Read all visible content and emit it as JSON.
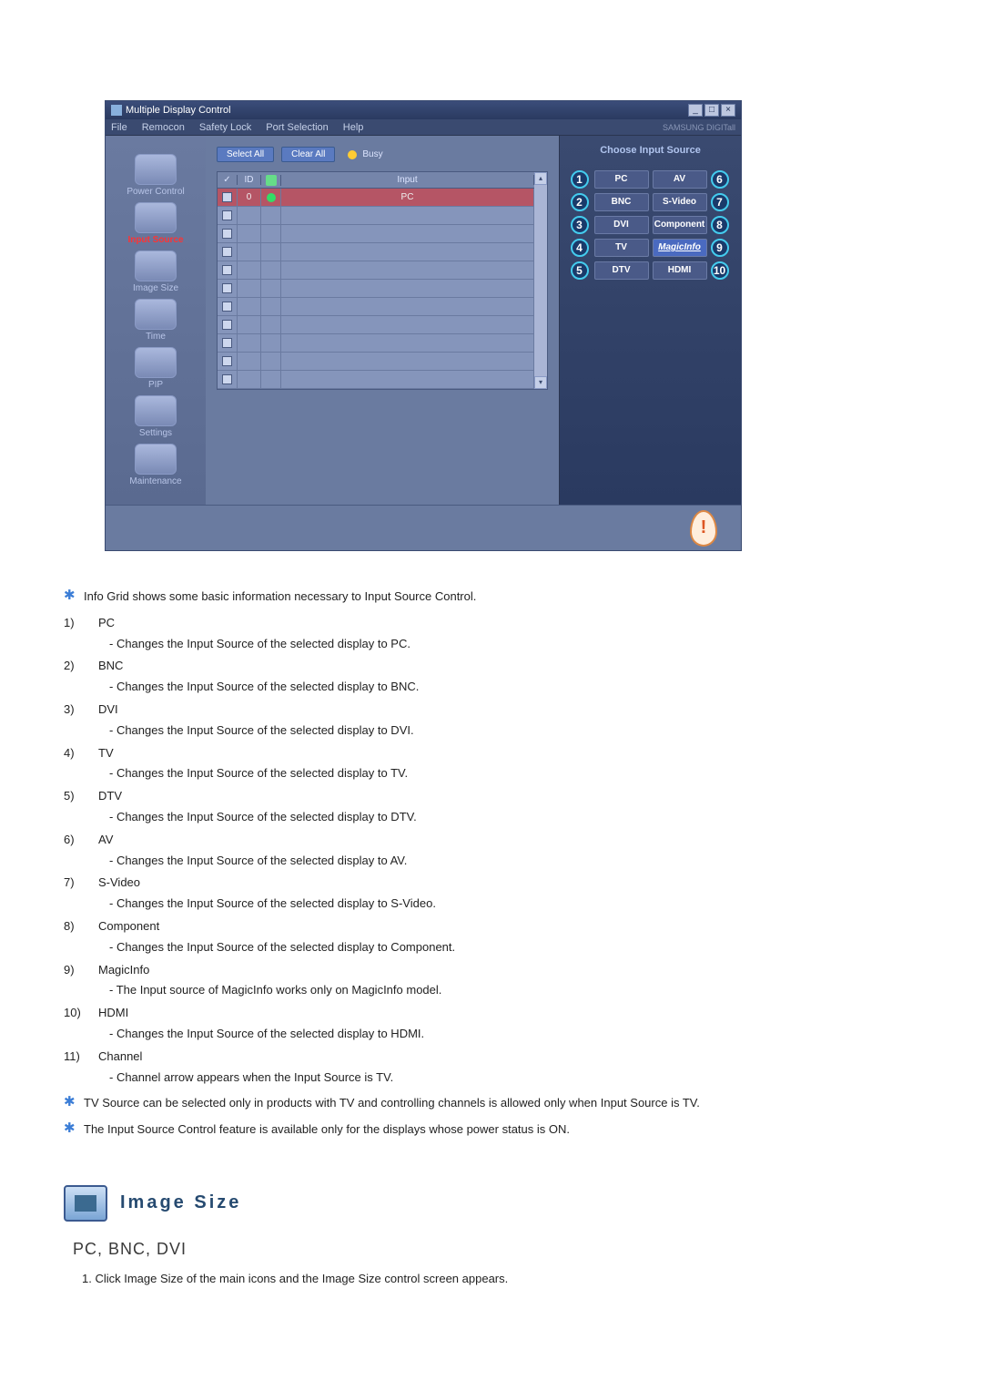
{
  "window": {
    "title": "Multiple Display Control",
    "menubar": [
      "File",
      "Remocon",
      "Safety Lock",
      "Port Selection",
      "Help"
    ],
    "brand": "SAMSUNG DIGITall"
  },
  "sidebar": {
    "items": [
      {
        "label": "Power Control",
        "active": false
      },
      {
        "label": "Input Source",
        "active": true
      },
      {
        "label": "Image Size",
        "active": false
      },
      {
        "label": "Time",
        "active": false
      },
      {
        "label": "PIP",
        "active": false
      },
      {
        "label": "Settings",
        "active": false
      },
      {
        "label": "Maintenance",
        "active": false
      }
    ]
  },
  "content": {
    "select_all": "Select All",
    "clear_all": "Clear All",
    "busy": "Busy",
    "grid_headers": {
      "check": "✓",
      "id": "ID",
      "status": "",
      "input": "Input"
    },
    "first_row_id": "0",
    "first_row_input": "PC"
  },
  "panel": {
    "title": "Choose Input Source",
    "sources": [
      {
        "n1": "1",
        "left": "PC",
        "right": "AV",
        "n2": "6"
      },
      {
        "n1": "2",
        "left": "BNC",
        "right": "S-Video",
        "n2": "7"
      },
      {
        "n1": "3",
        "left": "DVI",
        "right": "Component",
        "n2": "8"
      },
      {
        "n1": "4",
        "left": "TV",
        "right": "MagicInfo",
        "n2": "9"
      },
      {
        "n1": "5",
        "left": "DTV",
        "right": "HDMI",
        "n2": "10"
      }
    ]
  },
  "doc": {
    "intro": "Info Grid shows some basic information necessary to Input Source Control.",
    "items": [
      {
        "n": "1)",
        "title": "PC",
        "desc": "- Changes the Input Source of the selected display to PC."
      },
      {
        "n": "2)",
        "title": "BNC",
        "desc": "- Changes the Input Source of the selected display to BNC."
      },
      {
        "n": "3)",
        "title": "DVI",
        "desc": "- Changes the Input Source of the selected display to DVI."
      },
      {
        "n": "4)",
        "title": "TV",
        "desc": "- Changes the Input Source of the selected display to TV."
      },
      {
        "n": "5)",
        "title": "DTV",
        "desc": "- Changes the Input Source of the selected display to DTV."
      },
      {
        "n": "6)",
        "title": "AV",
        "desc": "- Changes the Input Source of the selected display to AV."
      },
      {
        "n": "7)",
        "title": "S-Video",
        "desc": "- Changes the Input Source of the selected display to S-Video."
      },
      {
        "n": "8)",
        "title": "Component",
        "desc": "- Changes the Input Source of the selected display to Component."
      },
      {
        "n": "9)",
        "title": "MagicInfo",
        "desc": "- The Input source of MagicInfo works only on MagicInfo model."
      },
      {
        "n": "10)",
        "title": "HDMI",
        "desc": "- Changes the Input Source of the selected display to HDMI."
      },
      {
        "n": "11)",
        "title": "Channel",
        "desc": "- Channel arrow appears when the Input Source is TV."
      }
    ],
    "note1": "TV Source can be selected only in products with TV and controlling channels is allowed only when Input Source is TV.",
    "note2": "The Input Source Control feature is available only for the displays whose power status is ON."
  },
  "section": {
    "title": "Image Size",
    "subheading": "PC, BNC, DVI",
    "instruction": "1. Click Image Size of the main icons and the Image Size control screen appears."
  }
}
